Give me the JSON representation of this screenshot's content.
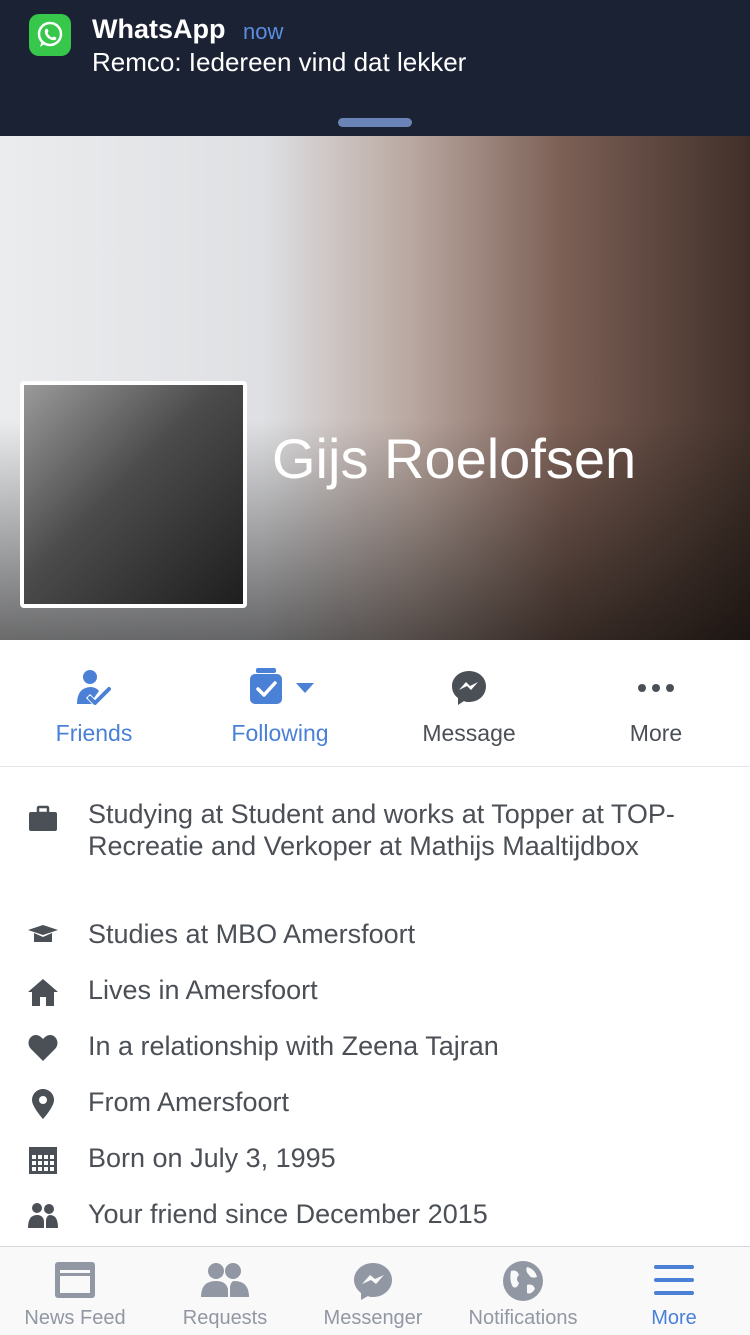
{
  "notification": {
    "app": "WhatsApp",
    "time": "now",
    "message": "Remco: Iedereen vind dat lekker"
  },
  "profile": {
    "name": "Gijs Roelofsen"
  },
  "actions": [
    {
      "label": "Friends",
      "icon": "friends-check-icon"
    },
    {
      "label": "Following",
      "icon": "following-icon"
    },
    {
      "label": "Message",
      "icon": "messenger-icon"
    },
    {
      "label": "More",
      "icon": "more-dots-icon"
    }
  ],
  "about": [
    {
      "icon": "briefcase-icon",
      "text": "Studying at Student and works at Topper at TOP-Recreatie and Verkoper at Mathijs Maaltijdbox"
    },
    {
      "icon": "graduation-cap-icon",
      "text": "Studies at MBO Amersfoort"
    },
    {
      "icon": "house-icon",
      "text": "Lives in Amersfoort"
    },
    {
      "icon": "heart-icon",
      "text": "In a relationship with Zeena Tajran"
    },
    {
      "icon": "location-pin-icon",
      "text": "From Amersfoort"
    },
    {
      "icon": "calendar-icon",
      "text": "Born on July 3, 1995"
    },
    {
      "icon": "friends-icon",
      "text": "Your friend since December 2015"
    }
  ],
  "tabs": [
    {
      "label": "News Feed",
      "icon": "news-feed-icon"
    },
    {
      "label": "Requests",
      "icon": "requests-icon"
    },
    {
      "label": "Messenger",
      "icon": "messenger-icon"
    },
    {
      "label": "Notifications",
      "icon": "globe-icon"
    },
    {
      "label": "More",
      "icon": "hamburger-icon",
      "active": true
    }
  ],
  "colors": {
    "accent": "#4a80d6",
    "text": "#4b4f56",
    "notification_bg": "#1b2233",
    "whatsapp_green": "#37c74a"
  }
}
